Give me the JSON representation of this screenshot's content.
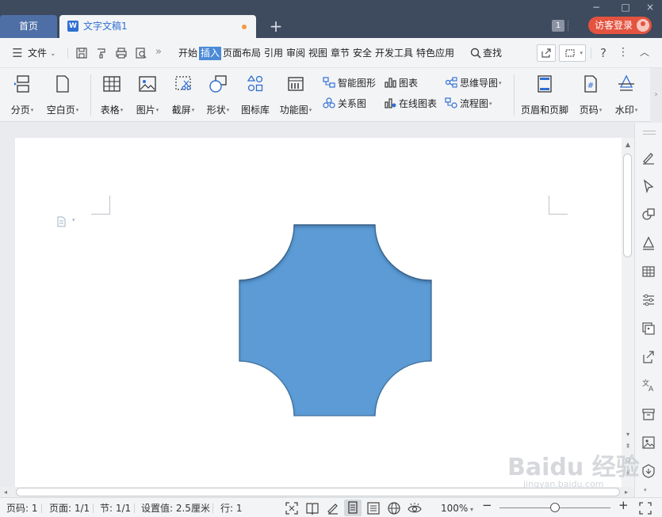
{
  "titlebar": {
    "home_tab": "首页",
    "doc_tab": "文字文稿1",
    "doc_icon": "W",
    "new_tab": "+",
    "badge_count": "1",
    "login_label": "访客登录",
    "window_controls": [
      "−",
      "□",
      "×"
    ]
  },
  "menubar": {
    "file_label": "文件",
    "more": "»",
    "items": [
      "开始",
      "插入",
      "页面布局",
      "引用",
      "审阅",
      "视图",
      "章节",
      "安全",
      "开发工具",
      "特色应用"
    ],
    "active_item": "插入",
    "search_label": "查找"
  },
  "ribbon": {
    "big_buttons": [
      {
        "label": "分页",
        "icon": "page-break-icon",
        "has_dropdown": true
      },
      {
        "label": "空白页",
        "icon": "blank-page-icon",
        "has_dropdown": true
      },
      {
        "label": "表格",
        "icon": "table-icon",
        "has_dropdown": true
      },
      {
        "label": "图片",
        "icon": "picture-icon",
        "has_dropdown": true
      },
      {
        "label": "截屏",
        "icon": "screenshot-icon",
        "has_dropdown": true
      },
      {
        "label": "形状",
        "icon": "shapes-icon",
        "has_dropdown": true
      },
      {
        "label": "图标库",
        "icon": "icon-library-icon",
        "has_dropdown": false
      },
      {
        "label": "功能图",
        "icon": "function-chart-icon",
        "has_dropdown": true
      },
      {
        "label": "页眉和页脚",
        "icon": "header-footer-icon",
        "has_dropdown": false
      },
      {
        "label": "页码",
        "icon": "page-number-icon",
        "has_dropdown": true
      },
      {
        "label": "水印",
        "icon": "watermark-icon",
        "has_dropdown": true
      }
    ],
    "small_buttons": [
      {
        "label": "智能图形",
        "icon": "smart-art-icon",
        "has_dropdown": false
      },
      {
        "label": "关系图",
        "icon": "relation-chart-icon",
        "has_dropdown": false
      },
      {
        "label": "图表",
        "icon": "chart-icon",
        "has_dropdown": false
      },
      {
        "label": "在线图表",
        "icon": "online-chart-icon",
        "has_dropdown": false
      },
      {
        "label": "思维导图",
        "icon": "mind-map-icon",
        "has_dropdown": true
      },
      {
        "label": "流程图",
        "icon": "flowchart-icon",
        "has_dropdown": true
      }
    ]
  },
  "document": {
    "shape_type": "plaque",
    "shape_fill": "#5b9bd5",
    "shape_stroke": "#41719c",
    "shape_shadow": true
  },
  "statusbar": {
    "page_num": "页码: 1",
    "pages": "页面: 1/1",
    "section": "节: 1/1",
    "setting": "设置值: 2.5厘米",
    "row": "行: 1",
    "zoom": "100%",
    "zoom_minus": "−",
    "zoom_plus": "+",
    "zoom_fraction": 0.5
  },
  "watermark": {
    "text": "Baidu 经验",
    "sub": "jingyan.baidu.com"
  },
  "colors": {
    "titlebar": "#3e4a5e",
    "home_tab": "#4e6fa6",
    "accent": "#4a8ad6",
    "login": "#e4533f"
  }
}
